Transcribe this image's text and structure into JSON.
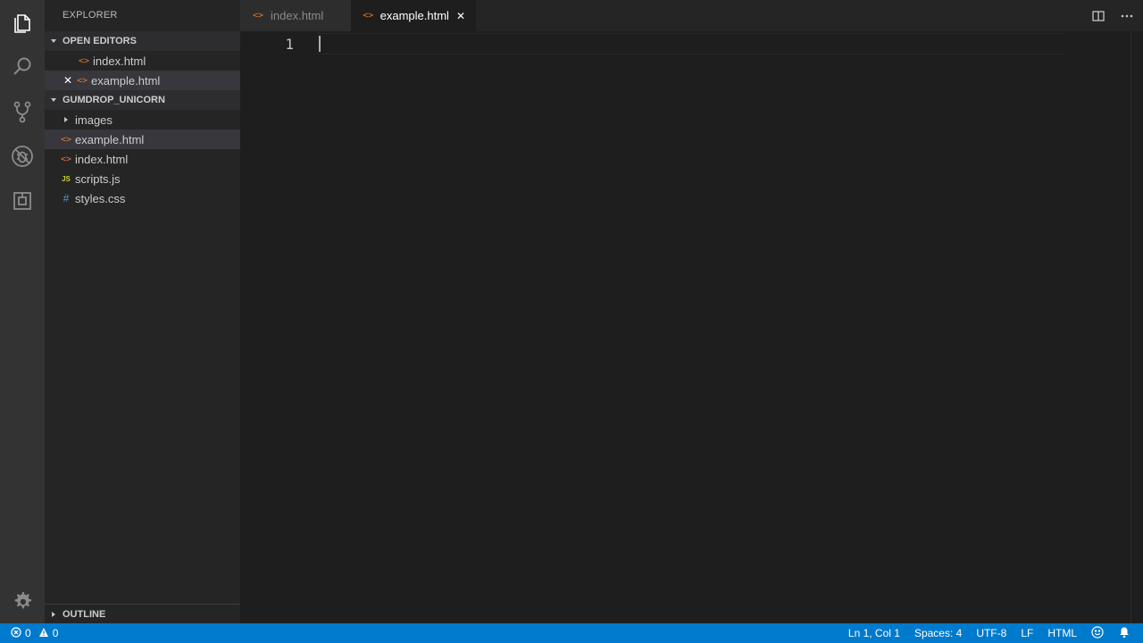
{
  "sidebar": {
    "title": "EXPLORER",
    "open_editors": {
      "label": "OPEN EDITORS",
      "items": [
        {
          "name": "index.html"
        },
        {
          "name": "example.html"
        }
      ]
    },
    "folder": {
      "label": "GUMDROP_UNICORN",
      "items": [
        {
          "name": "images",
          "type": "folder"
        },
        {
          "name": "example.html",
          "type": "html"
        },
        {
          "name": "index.html",
          "type": "html"
        },
        {
          "name": "scripts.js",
          "type": "js"
        },
        {
          "name": "styles.css",
          "type": "css"
        }
      ]
    },
    "outline_label": "OUTLINE"
  },
  "icons": {
    "html": "<>",
    "js": "JS",
    "css": "#",
    "close": "✕"
  },
  "tabs": [
    {
      "label": "index.html",
      "active": false
    },
    {
      "label": "example.html",
      "active": true
    }
  ],
  "editor": {
    "line_number": "1"
  },
  "status": {
    "errors": "0",
    "warnings": "0",
    "position": "Ln 1, Col 1",
    "spaces": "Spaces: 4",
    "encoding": "UTF-8",
    "eol": "LF",
    "language": "HTML"
  },
  "colors": {
    "accent": "#007acc",
    "html_icon": "#e37933",
    "js_icon": "#cbcb41",
    "css_icon": "#519aba"
  }
}
